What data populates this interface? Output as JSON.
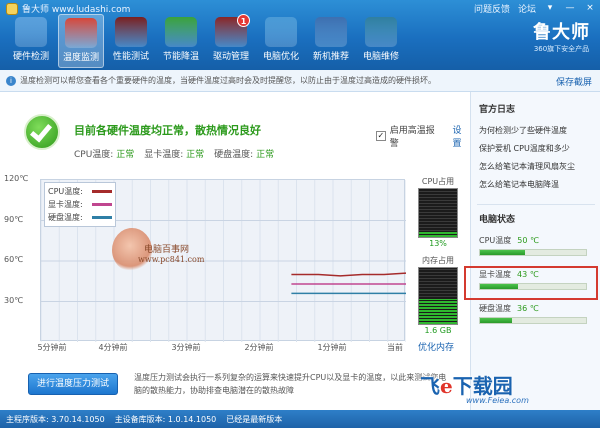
{
  "window": {
    "title": "鲁大师 www.ludashi.com",
    "links": [
      "问题反馈",
      "论坛"
    ],
    "controls": [
      "▾",
      "—",
      "×"
    ]
  },
  "nav": [
    {
      "label": "硬件检测",
      "icon": "magnifier-computer-icon",
      "color": "#5aa0dc"
    },
    {
      "label": "温度监测",
      "icon": "thermometer-icon",
      "color": "#d6473a"
    },
    {
      "label": "性能测试",
      "icon": "speedometer-icon",
      "color": "#7a1f1f"
    },
    {
      "label": "节能降温",
      "icon": "clover-icon",
      "color": "#3aa23a"
    },
    {
      "label": "驱动管理",
      "icon": "driver-chip-icon",
      "color": "#8a2525",
      "badge": "1"
    },
    {
      "label": "电脑优化",
      "icon": "optimize-icon",
      "color": "#4a9ad6"
    },
    {
      "label": "新机推荐",
      "icon": "monitor-icon",
      "color": "#3d6fb0"
    },
    {
      "label": "电脑维修",
      "icon": "repair-icon",
      "color": "#2f7f9f"
    }
  ],
  "brand": {
    "name": "鲁大师",
    "sub": "360旗下安全产品"
  },
  "infobar": {
    "text": "温度检测可以帮您查看各个重要硬件的温度，当硬件温度过高时会及时提醒您，以防止由于温度过高造成的硬件损坏。",
    "save": "保存截屏"
  },
  "status": {
    "title": "目前各硬件温度均正常，散热情况良好",
    "temps": [
      {
        "label": "CPU温度:",
        "value": "正常"
      },
      {
        "label": "显卡温度:",
        "value": "正常"
      },
      {
        "label": "硬盘温度:",
        "value": "正常"
      }
    ],
    "alarm_label": "启用高温报警",
    "alarm_checked": "✓",
    "settings": "设置"
  },
  "chart_data": {
    "type": "line",
    "yticks": [
      "120℃",
      "90℃",
      "60℃",
      "30℃"
    ],
    "ylim": [
      0,
      120
    ],
    "xticks": [
      "5分钟前",
      "4分钟前",
      "3分钟前",
      "2分钟前",
      "1分钟前",
      "当前"
    ],
    "legend_placement": "top-left",
    "series": [
      {
        "name": "CPU温度:",
        "color": "#a52b2b",
        "x": [
          -1.57,
          -1.2,
          -0.9,
          -0.6,
          -0.3,
          0
        ],
        "values": [
          50,
          50,
          49,
          50,
          50,
          51
        ]
      },
      {
        "name": "显卡温度:",
        "color": "#c0468f",
        "x": [
          -1.57,
          -1.2,
          -0.9,
          -0.6,
          -0.3,
          0
        ],
        "values": [
          43,
          43,
          43,
          43,
          43,
          43
        ]
      },
      {
        "name": "硬盘温度:",
        "color": "#2f7fa6",
        "x": [
          -1.57,
          -1.2,
          -0.9,
          -0.6,
          -0.3,
          0
        ],
        "values": [
          36,
          36,
          36,
          36,
          36,
          36
        ]
      }
    ]
  },
  "watermark": {
    "text": "电脑百事网",
    "url": "www.pc841.com"
  },
  "cpu_usage": {
    "label": "CPU占用",
    "value": "13%",
    "fraction": 0.13
  },
  "mem_usage": {
    "label": "内存占用",
    "value": "1.6 GB",
    "fraction": 0.45
  },
  "optimize_memory": "优化内存",
  "stress": {
    "button": "进行温度压力测试",
    "text": "温度压力测试会执行一系列复杂的运算来快速提升CPU以及显卡的温度，以此来测试您电脑的散热能力，协助排查电脑潜在的散热故障"
  },
  "sidebar": {
    "news_title": "官方日志",
    "news": [
      "为何检测少了些硬件温度",
      "保护爱机 CPU温度和多少",
      "怎么给笔记本清理风扇灰尘",
      "怎么给笔记本电脑降温"
    ],
    "state_title": "电脑状态",
    "states": [
      {
        "label": "CPU温度",
        "value": "50 ℃",
        "fraction": 0.42
      },
      {
        "label": "显卡温度",
        "value": "43 ℃",
        "fraction": 0.36
      },
      {
        "label": "硬盘温度",
        "value": "36 ℃",
        "fraction": 0.3
      }
    ]
  },
  "statusbar": [
    "主程序版本: 3.70.14.1050",
    "主设备库版本: 1.0.14.1050",
    "已经是最新版本"
  ],
  "site_logo": {
    "pre": "飞",
    "e": "e",
    "post": "下载园",
    "url": "www.Feiea.com"
  }
}
